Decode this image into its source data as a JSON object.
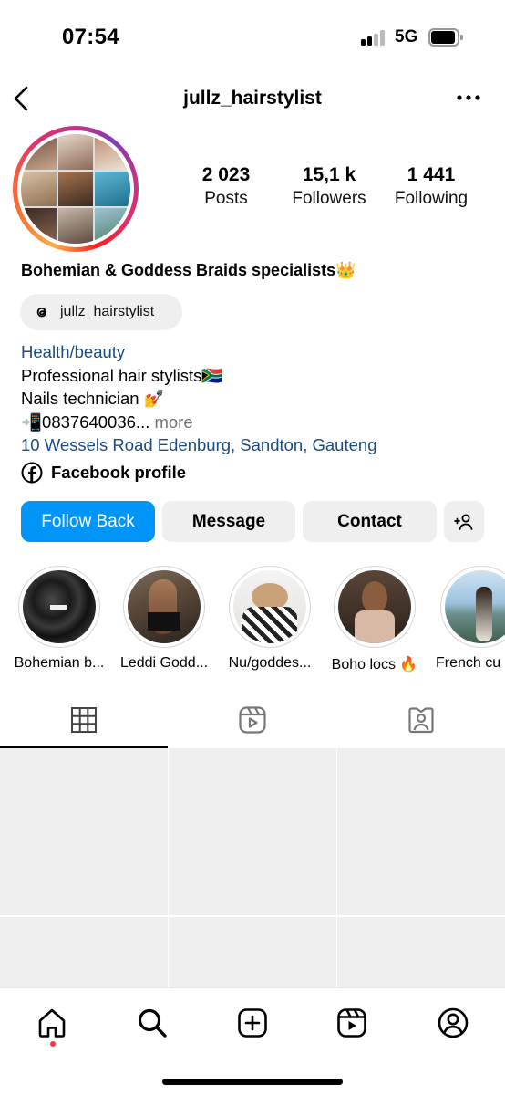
{
  "status": {
    "time": "07:54",
    "network": "5G"
  },
  "header": {
    "username": "jullz_hairstylist"
  },
  "stats": [
    {
      "value": "2 023",
      "label": "Posts"
    },
    {
      "value": "15,1 k",
      "label": "Followers"
    },
    {
      "value": "1 441",
      "label": "Following"
    }
  ],
  "profile": {
    "display_name": "Bohemian & Goddess Braids specialists👑",
    "threads_handle": "jullz_hairstylist",
    "category": "Health/beauty",
    "bio_line1": "Professional hair stylists🇿🇦",
    "bio_line2": "Nails technician 💅",
    "bio_line3": "📲0837640036...",
    "more": " more",
    "address": "10 Wessels Road Edenburg, Sandton, Gauteng",
    "facebook": "Facebook profile"
  },
  "actions": {
    "follow": "Follow Back",
    "message": "Message",
    "contact": "Contact"
  },
  "highlights": [
    {
      "label": "Bohemian b..."
    },
    {
      "label": "Leddi Godd..."
    },
    {
      "label": "Nu/goddes..."
    },
    {
      "label": "Boho locs 🔥"
    },
    {
      "label": "French cu"
    }
  ],
  "colors": {
    "accent": "#0095f6",
    "link": "#1b4b7f",
    "secondary": "#737373",
    "notification": "#ff3040"
  },
  "icons": {
    "back": "chevron-left-icon",
    "more": "more-horizontal-icon",
    "threads": "threads-icon",
    "facebook": "facebook-icon",
    "add_person": "add-person-icon",
    "grid": "grid-icon",
    "reels": "reels-icon",
    "tagged": "tagged-icon",
    "home": "home-icon",
    "search": "search-icon",
    "create": "create-icon",
    "reels_nav": "reels-nav-icon",
    "profile": "profile-icon"
  }
}
